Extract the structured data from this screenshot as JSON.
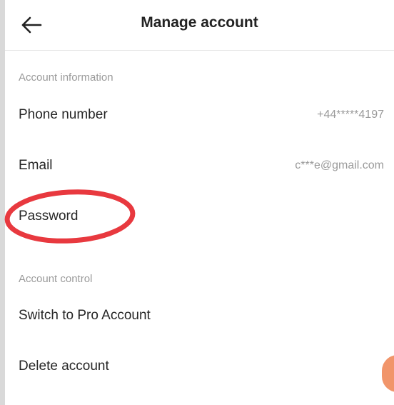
{
  "header": {
    "title": "Manage account",
    "back_icon": "arrow-left-icon"
  },
  "sections": {
    "account_information": {
      "label": "Account information",
      "items": [
        {
          "label": "Phone number",
          "value": "+44*****4197"
        },
        {
          "label": "Email",
          "value": "c***e@gmail.com"
        },
        {
          "label": "Password",
          "value": ""
        }
      ]
    },
    "account_control": {
      "label": "Account control",
      "items": [
        {
          "label": "Switch to Pro Account"
        },
        {
          "label": "Delete account"
        }
      ]
    }
  },
  "colors": {
    "annotation_circle": "#e8393f",
    "section_label": "#9a9a9a",
    "text": "#262626",
    "floating_button": "#f08a5a"
  }
}
